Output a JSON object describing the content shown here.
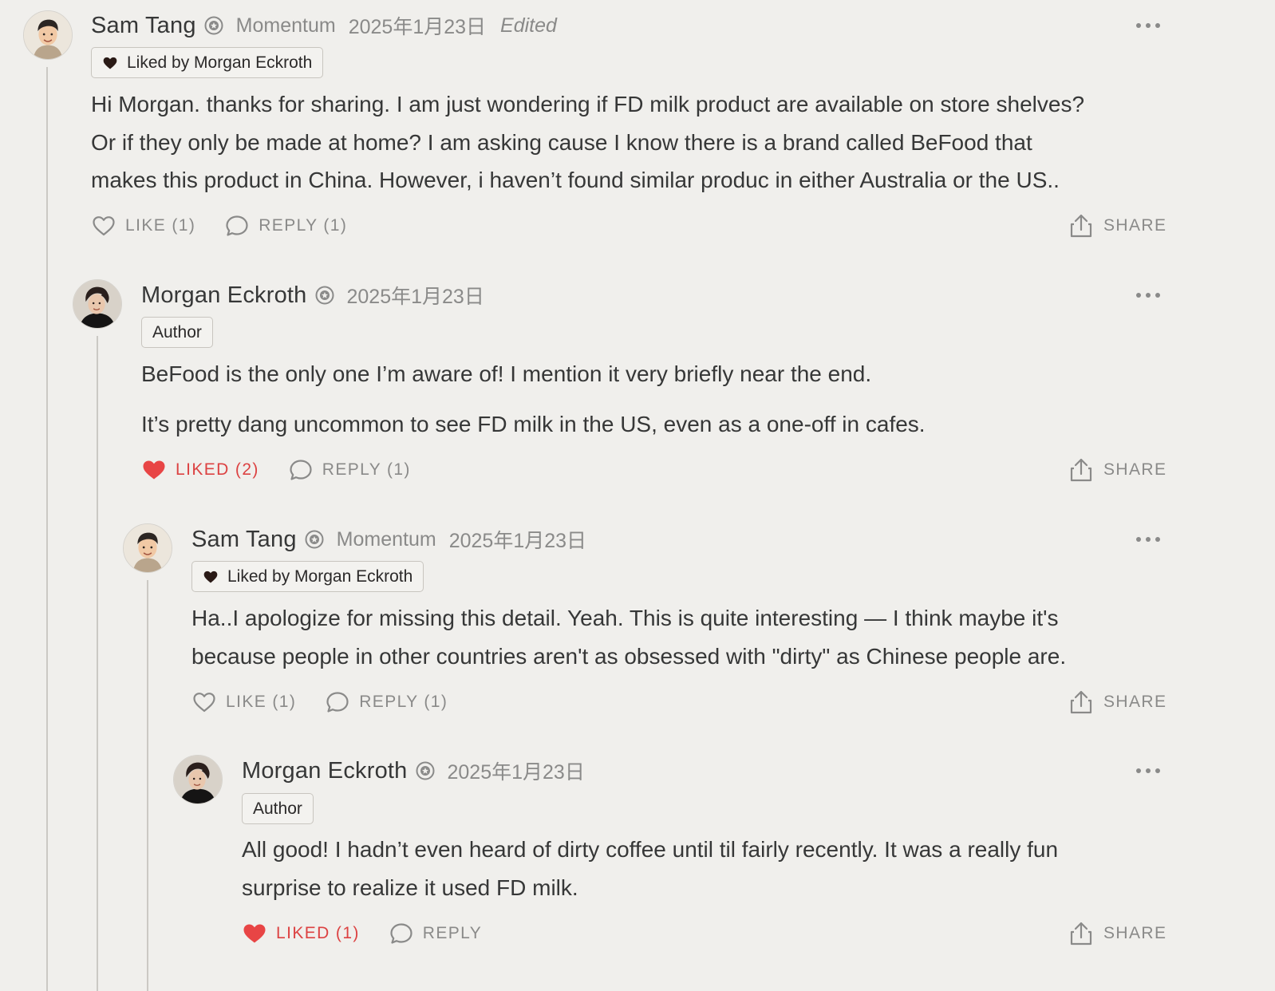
{
  "comments": [
    {
      "author": "Sam Tang",
      "publication": "Momentum",
      "date": "2025年1月23日",
      "edited": "Edited",
      "chip_label": "Liked by Morgan Eckroth",
      "body": [
        "Hi Morgan. thanks for sharing. I am just wondering if FD milk product are available on store shelves?",
        "Or if they only be made at home? I am asking cause I know there is a brand called BeFood that",
        "makes this product in China. However, i haven’t found similar produc in either Australia or the US.."
      ],
      "like_label": "LIKE (1)",
      "reply_label": "REPLY (1)",
      "share_label": "SHARE"
    },
    {
      "author": "Morgan Eckroth",
      "date": "2025年1月23日",
      "chip_label": "Author",
      "body": [
        "BeFood is the only one I’m aware of! I mention it very briefly near the end.",
        "It’s pretty dang uncommon to see FD milk in the US, even as a one-off in cafes."
      ],
      "like_label": "LIKED (2)",
      "reply_label": "REPLY (1)",
      "share_label": "SHARE"
    },
    {
      "author": "Sam Tang",
      "publication": "Momentum",
      "date": "2025年1月23日",
      "chip_label": "Liked by Morgan Eckroth",
      "body": [
        "Ha..I apologize for missing this detail. Yeah. This is quite interesting — I think maybe it's",
        "because people in other countries aren't as obsessed with \"dirty\" as Chinese people are."
      ],
      "like_label": "LIKE (1)",
      "reply_label": "REPLY (1)",
      "share_label": "SHARE"
    },
    {
      "author": "Morgan Eckroth",
      "date": "2025年1月23日",
      "chip_label": "Author",
      "body": [
        "All good! I hadn’t even heard of dirty coffee until til fairly recently. It was a really fun",
        "surprise to realize it used FD milk."
      ],
      "like_label": "LIKED (1)",
      "reply_label": "REPLY",
      "share_label": "SHARE"
    }
  ],
  "icons": {
    "avatar_sam": "sam-tang-avatar",
    "avatar_morgan": "morgan-eckroth-avatar",
    "badge": "verified-badge-icon",
    "heart_outline": "heart-outline-icon",
    "heart_filled": "heart-filled-icon",
    "reply": "speech-bubble-icon",
    "share": "share-icon",
    "more": "more-options-icon"
  },
  "colors": {
    "background": "#f0efec",
    "text": "#363737",
    "muted": "#8a8a89",
    "liked": "#dc4242",
    "thread_line": "#cbc9c4"
  }
}
